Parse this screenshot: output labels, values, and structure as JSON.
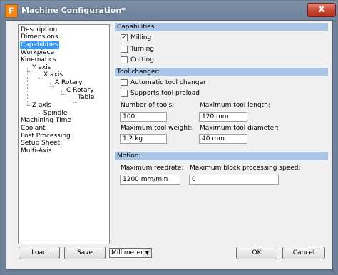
{
  "window": {
    "title": "Machine Configuration*",
    "close_label": "X",
    "app_icon_label": "F"
  },
  "tree": {
    "items": [
      "Description",
      "Dimensions",
      "Capabilities",
      "Workpiece",
      "Kinematics",
      "Y axis",
      "X axis",
      "A Rotary",
      "C Rotary",
      "Table",
      "Z axis",
      "Spindle",
      "Machining Time",
      "Coolant",
      "Post Processing",
      "Setup Sheet",
      "Multi-Axis"
    ],
    "selected": "Capabilities"
  },
  "capabilities": {
    "header": "Capabilities",
    "options": [
      {
        "label": "Milling",
        "checked": true
      },
      {
        "label": "Turning",
        "checked": false
      },
      {
        "label": "Cutting",
        "checked": false
      }
    ]
  },
  "tool_changer": {
    "header": "Tool changer:",
    "options": [
      {
        "label": "Automatic tool changer",
        "checked": false
      },
      {
        "label": "Supports tool preload",
        "checked": false
      }
    ],
    "fields": {
      "num_tools": {
        "label": "Number of tools:",
        "value": "100"
      },
      "max_length": {
        "label": "Maximum tool length:",
        "value": "120 mm"
      },
      "max_weight": {
        "label": "Maximum tool weight:",
        "value": "1.2 kg"
      },
      "max_diameter": {
        "label": "Maximum tool diameter:",
        "value": "40 mm"
      }
    }
  },
  "motion": {
    "header": "Motion:",
    "fields": {
      "max_feedrate": {
        "label": "Maximum feedrate:",
        "value": "1200 mm/min"
      },
      "max_block_speed": {
        "label": "Maximum block processing speed:",
        "value": "0"
      }
    }
  },
  "footer": {
    "load_label": "Load",
    "save_label": "Save",
    "units_value": "Millimeters",
    "ok_label": "OK",
    "cancel_label": "Cancel"
  }
}
